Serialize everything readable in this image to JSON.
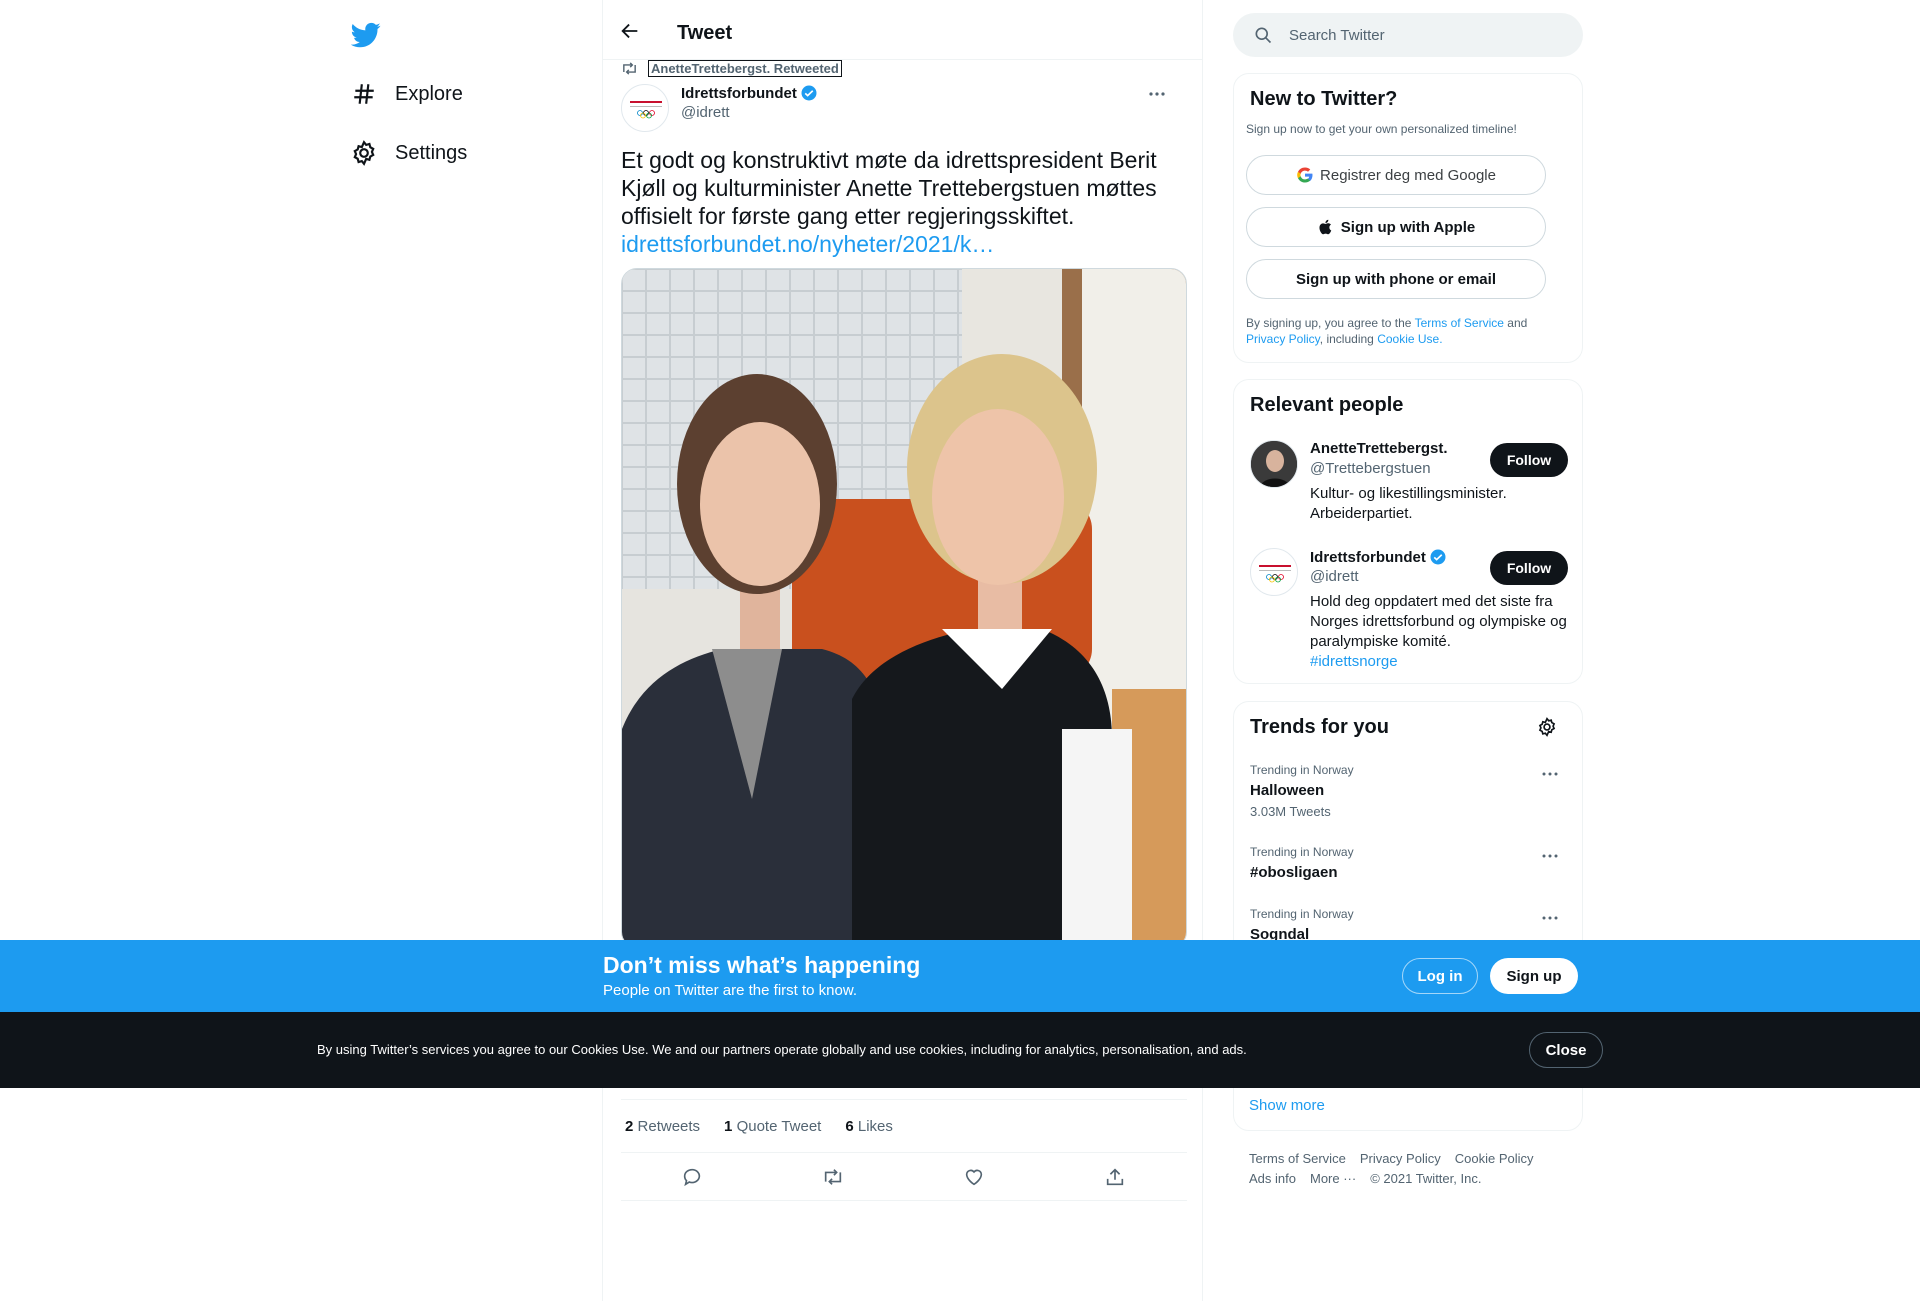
{
  "nav": {
    "items": [
      {
        "label": "Explore",
        "icon": "hashtag-icon"
      },
      {
        "label": "Settings",
        "icon": "gear-icon"
      }
    ]
  },
  "header": {
    "title": "Tweet"
  },
  "tweet": {
    "retweeted_by": "AnetteTrettebergst. Retweeted",
    "author_name": "Idrettsforbundet",
    "author_handle": "@idrett",
    "text": "Et godt og konstruktivt møte da idrettspresident Berit Kjøll og kulturminister Anette Trettebergstuen møttes offisielt for første gang etter regjeringsskiftet.",
    "link": "idrettsforbundet.no/nyheter/2021/k…",
    "stats": {
      "retweets_count": "2",
      "retweets_label": "Retweets",
      "quotes_count": "1",
      "quotes_label": "Quote Tweet",
      "likes_count": "6",
      "likes_label": "Likes"
    }
  },
  "search": {
    "placeholder": "Search Twitter"
  },
  "new_to_twitter": {
    "title": "New to Twitter?",
    "subtitle": "Sign up now to get your own personalized timeline!",
    "google_label": "Registrer deg med Google",
    "apple_label": "Sign up with Apple",
    "phone_label": "Sign up with phone or email",
    "legal_prefix": "By signing up, you agree to the",
    "terms": "Terms of Service",
    "and": "and",
    "privacy": "Privacy Policy",
    "including": ", including",
    "cookie": "Cookie Use."
  },
  "relevant_people": {
    "title": "Relevant people",
    "people": [
      {
        "name": "AnetteTrettebergst.",
        "handle": "@Trettebergstuen",
        "bio": "Kultur- og likestillingsminister. Arbeiderpartiet.",
        "follow": "Follow"
      },
      {
        "name": "Idrettsforbundet",
        "handle": "@idrett",
        "bio": "Hold deg oppdatert med det siste fra Norges idrettsforbund og olympiske og paralympiske komité.",
        "tag": "#idrettsnorge",
        "follow": "Follow"
      }
    ]
  },
  "trends": {
    "title": "Trends for you",
    "items": [
      {
        "context": "Trending in Norway",
        "name": "Halloween",
        "count": "3.03M Tweets"
      },
      {
        "context": "Trending in Norway",
        "name": "#obosligaen"
      },
      {
        "context": "Trending in Norway",
        "name": "Sogndal"
      }
    ],
    "show_more": "Show more"
  },
  "footer": {
    "links": [
      "Terms of Service",
      "Privacy Policy",
      "Cookie Policy"
    ],
    "ads_info": "Ads info",
    "more": "More ···",
    "copyright": "© 2021 Twitter, Inc."
  },
  "banner": {
    "title": "Don’t miss what’s happening",
    "subtitle": "People on Twitter are the first to know.",
    "login": "Log in",
    "signup": "Sign up"
  },
  "cookie_bar": {
    "text": "By using Twitter’s services you agree to our Cookies Use. We and our partners operate globally and use cookies, including for analytics, personalisation, and ads.",
    "close": "Close"
  },
  "colors": {
    "accent": "#1d9bf0",
    "dark": "#0f1419",
    "muted": "#536471"
  }
}
